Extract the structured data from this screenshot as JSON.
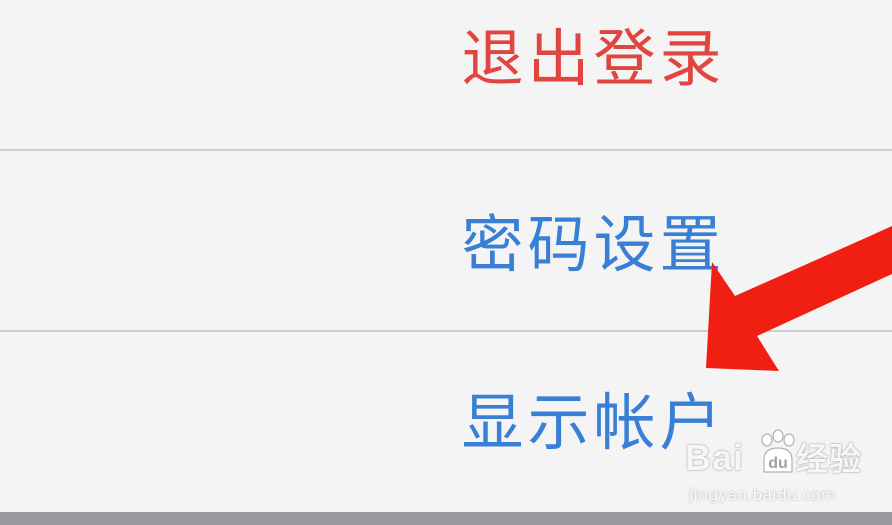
{
  "action_sheet": {
    "items": [
      {
        "label": "退出登录",
        "color": "#e0453f"
      },
      {
        "label": "密码设置",
        "color": "#3a7fd6"
      },
      {
        "label": "显示帐户",
        "color": "#3a7fd6"
      }
    ]
  },
  "annotation": {
    "arrow_color": "#f01f12",
    "arrow_icon": "red-arrow-pointer"
  },
  "watermark": {
    "logo_text": "Bai",
    "logo_text_2": "经验",
    "url": "jingyan.baidu.com"
  }
}
